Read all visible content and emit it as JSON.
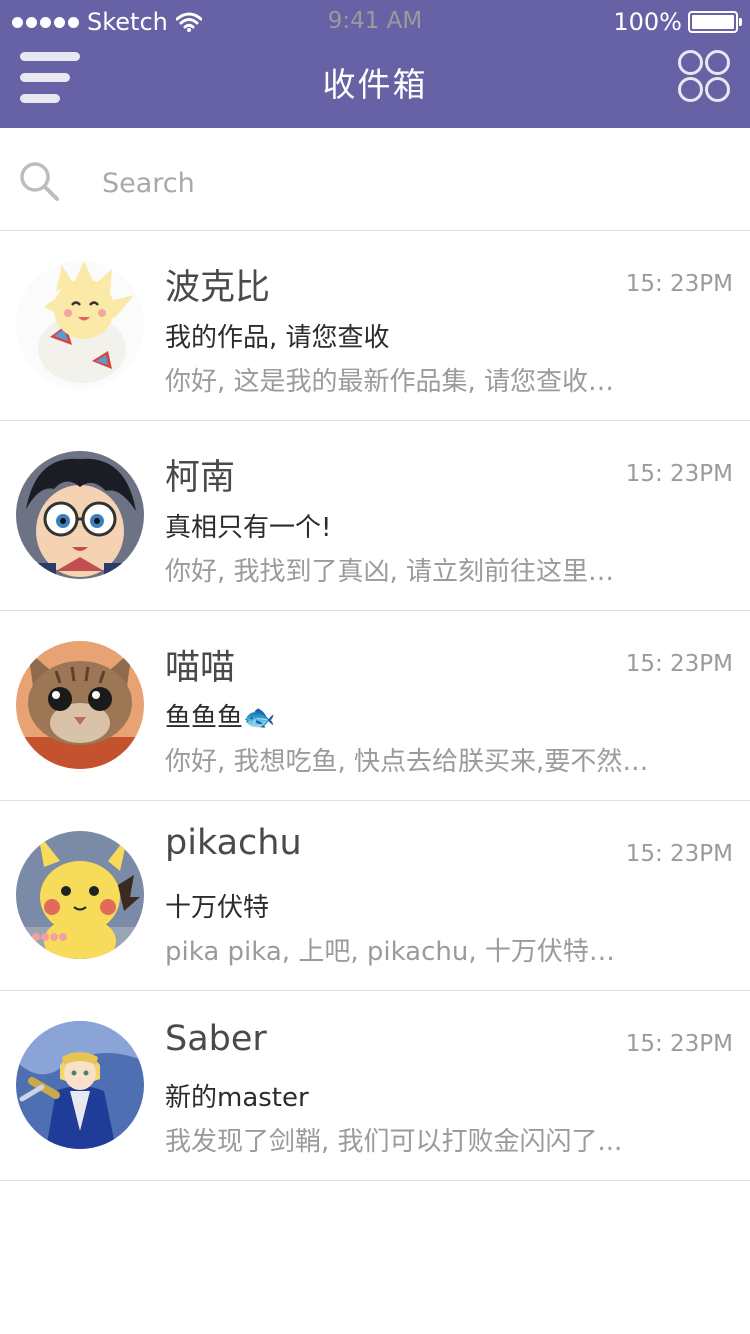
{
  "status_bar": {
    "carrier": "Sketch",
    "time": "9:41 AM",
    "battery": "100%",
    "icons": [
      "signal-dots-icon",
      "wifi-icon",
      "battery-icon"
    ]
  },
  "header": {
    "title": "收件箱",
    "left_icon": "menu-icon",
    "right_icon": "grid-icon",
    "background": "#6762a6"
  },
  "search": {
    "placeholder": "Search",
    "icon": "search-icon"
  },
  "messages": [
    {
      "name": "波克比",
      "time": "15: 23PM",
      "subject": "我的作品, 请您查收",
      "preview": "你好, 这是我的最新作品集, 请您查收…"
    },
    {
      "name": "柯南",
      "time": "15: 23PM",
      "subject": "真相只有一个!",
      "preview": "你好, 我找到了真凶, 请立刻前往这里…"
    },
    {
      "name": "喵喵",
      "time": "15: 23PM",
      "subject": "鱼鱼鱼🐟",
      "preview": "你好, 我想吃鱼, 快点去给朕买来,要不然…"
    },
    {
      "name": "pikachu",
      "time": "15: 23PM",
      "subject": "十万伏特",
      "preview": "pika pika, 上吧, pikachu, 十万伏特…"
    },
    {
      "name": "Saber",
      "time": "15: 23PM",
      "subject": "新的master",
      "preview": "我发现了剑鞘, 我们可以打败金闪闪了..."
    }
  ]
}
